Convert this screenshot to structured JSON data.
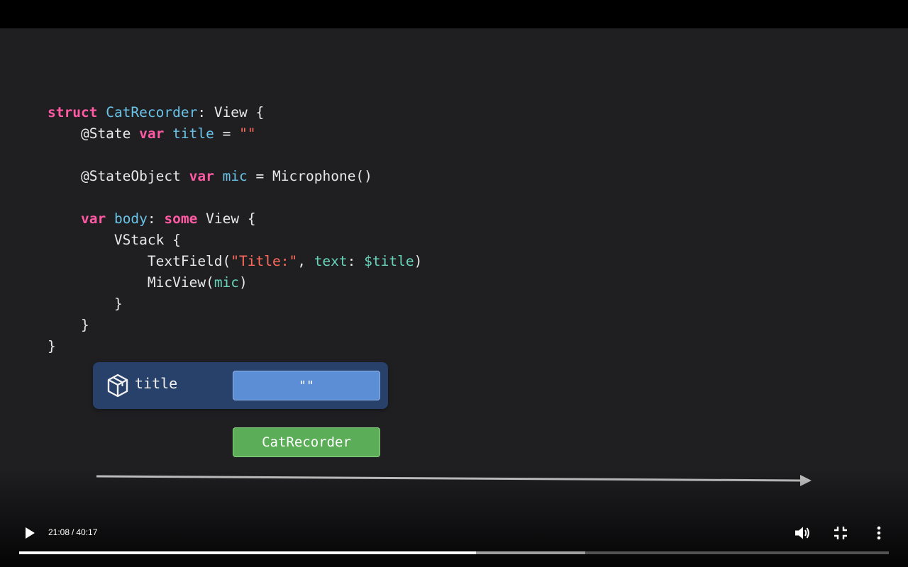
{
  "code": {
    "lines": [
      [
        {
          "t": "struct",
          "c": "kw"
        },
        {
          "t": " ",
          "c": "fn"
        },
        {
          "t": "CatRecorder",
          "c": "ty"
        },
        {
          "t": ": View {",
          "c": "fn"
        }
      ],
      [
        {
          "t": "    @State ",
          "c": "fn"
        },
        {
          "t": "var",
          "c": "kw"
        },
        {
          "t": " ",
          "c": "fn"
        },
        {
          "t": "title",
          "c": "ty"
        },
        {
          "t": " = ",
          "c": "fn"
        },
        {
          "t": "\"\"",
          "c": "str"
        }
      ],
      [],
      [
        {
          "t": "    @StateObject ",
          "c": "fn"
        },
        {
          "t": "var",
          "c": "kw"
        },
        {
          "t": " ",
          "c": "fn"
        },
        {
          "t": "mic",
          "c": "ty"
        },
        {
          "t": " = Microphone()",
          "c": "fn"
        }
      ],
      [],
      [
        {
          "t": "    ",
          "c": "fn"
        },
        {
          "t": "var",
          "c": "kw"
        },
        {
          "t": " ",
          "c": "fn"
        },
        {
          "t": "body",
          "c": "ty"
        },
        {
          "t": ": ",
          "c": "fn"
        },
        {
          "t": "some",
          "c": "kw"
        },
        {
          "t": " View {",
          "c": "fn"
        }
      ],
      [
        {
          "t": "        VStack {",
          "c": "fn"
        }
      ],
      [
        {
          "t": "            TextField(",
          "c": "fn"
        },
        {
          "t": "\"Title:\"",
          "c": "str"
        },
        {
          "t": ", ",
          "c": "fn"
        },
        {
          "t": "text",
          "c": "arg"
        },
        {
          "t": ": ",
          "c": "fn"
        },
        {
          "t": "$title",
          "c": "arg"
        },
        {
          "t": ")",
          "c": "fn"
        }
      ],
      [
        {
          "t": "            MicView(",
          "c": "fn"
        },
        {
          "t": "mic",
          "c": "arg"
        },
        {
          "t": ")",
          "c": "fn"
        }
      ],
      [
        {
          "t": "        }",
          "c": "fn"
        }
      ],
      [
        {
          "t": "    }",
          "c": "fn"
        }
      ],
      [
        {
          "t": "}",
          "c": "fn"
        }
      ]
    ]
  },
  "diagram": {
    "state_label": "title",
    "state_value": "\"\"",
    "view_label": "CatRecorder"
  },
  "player": {
    "current_time": "21:08",
    "separator": "/",
    "duration": "40:17",
    "played_fraction": 0.5249,
    "buffered_fraction": 0.6509,
    "icons": {
      "play": "play-icon",
      "volume": "volume-icon",
      "exit_fullscreen": "exit-fullscreen-icon",
      "more": "more-vert-icon"
    }
  },
  "colors": {
    "keyword": "#ff5aa3",
    "type": "#6ac3e8",
    "string": "#fc6a5d",
    "argument": "#67d3b8",
    "state_box": "#27416a",
    "state_value": "#5b8ed5",
    "view_box": "#5cad58"
  }
}
